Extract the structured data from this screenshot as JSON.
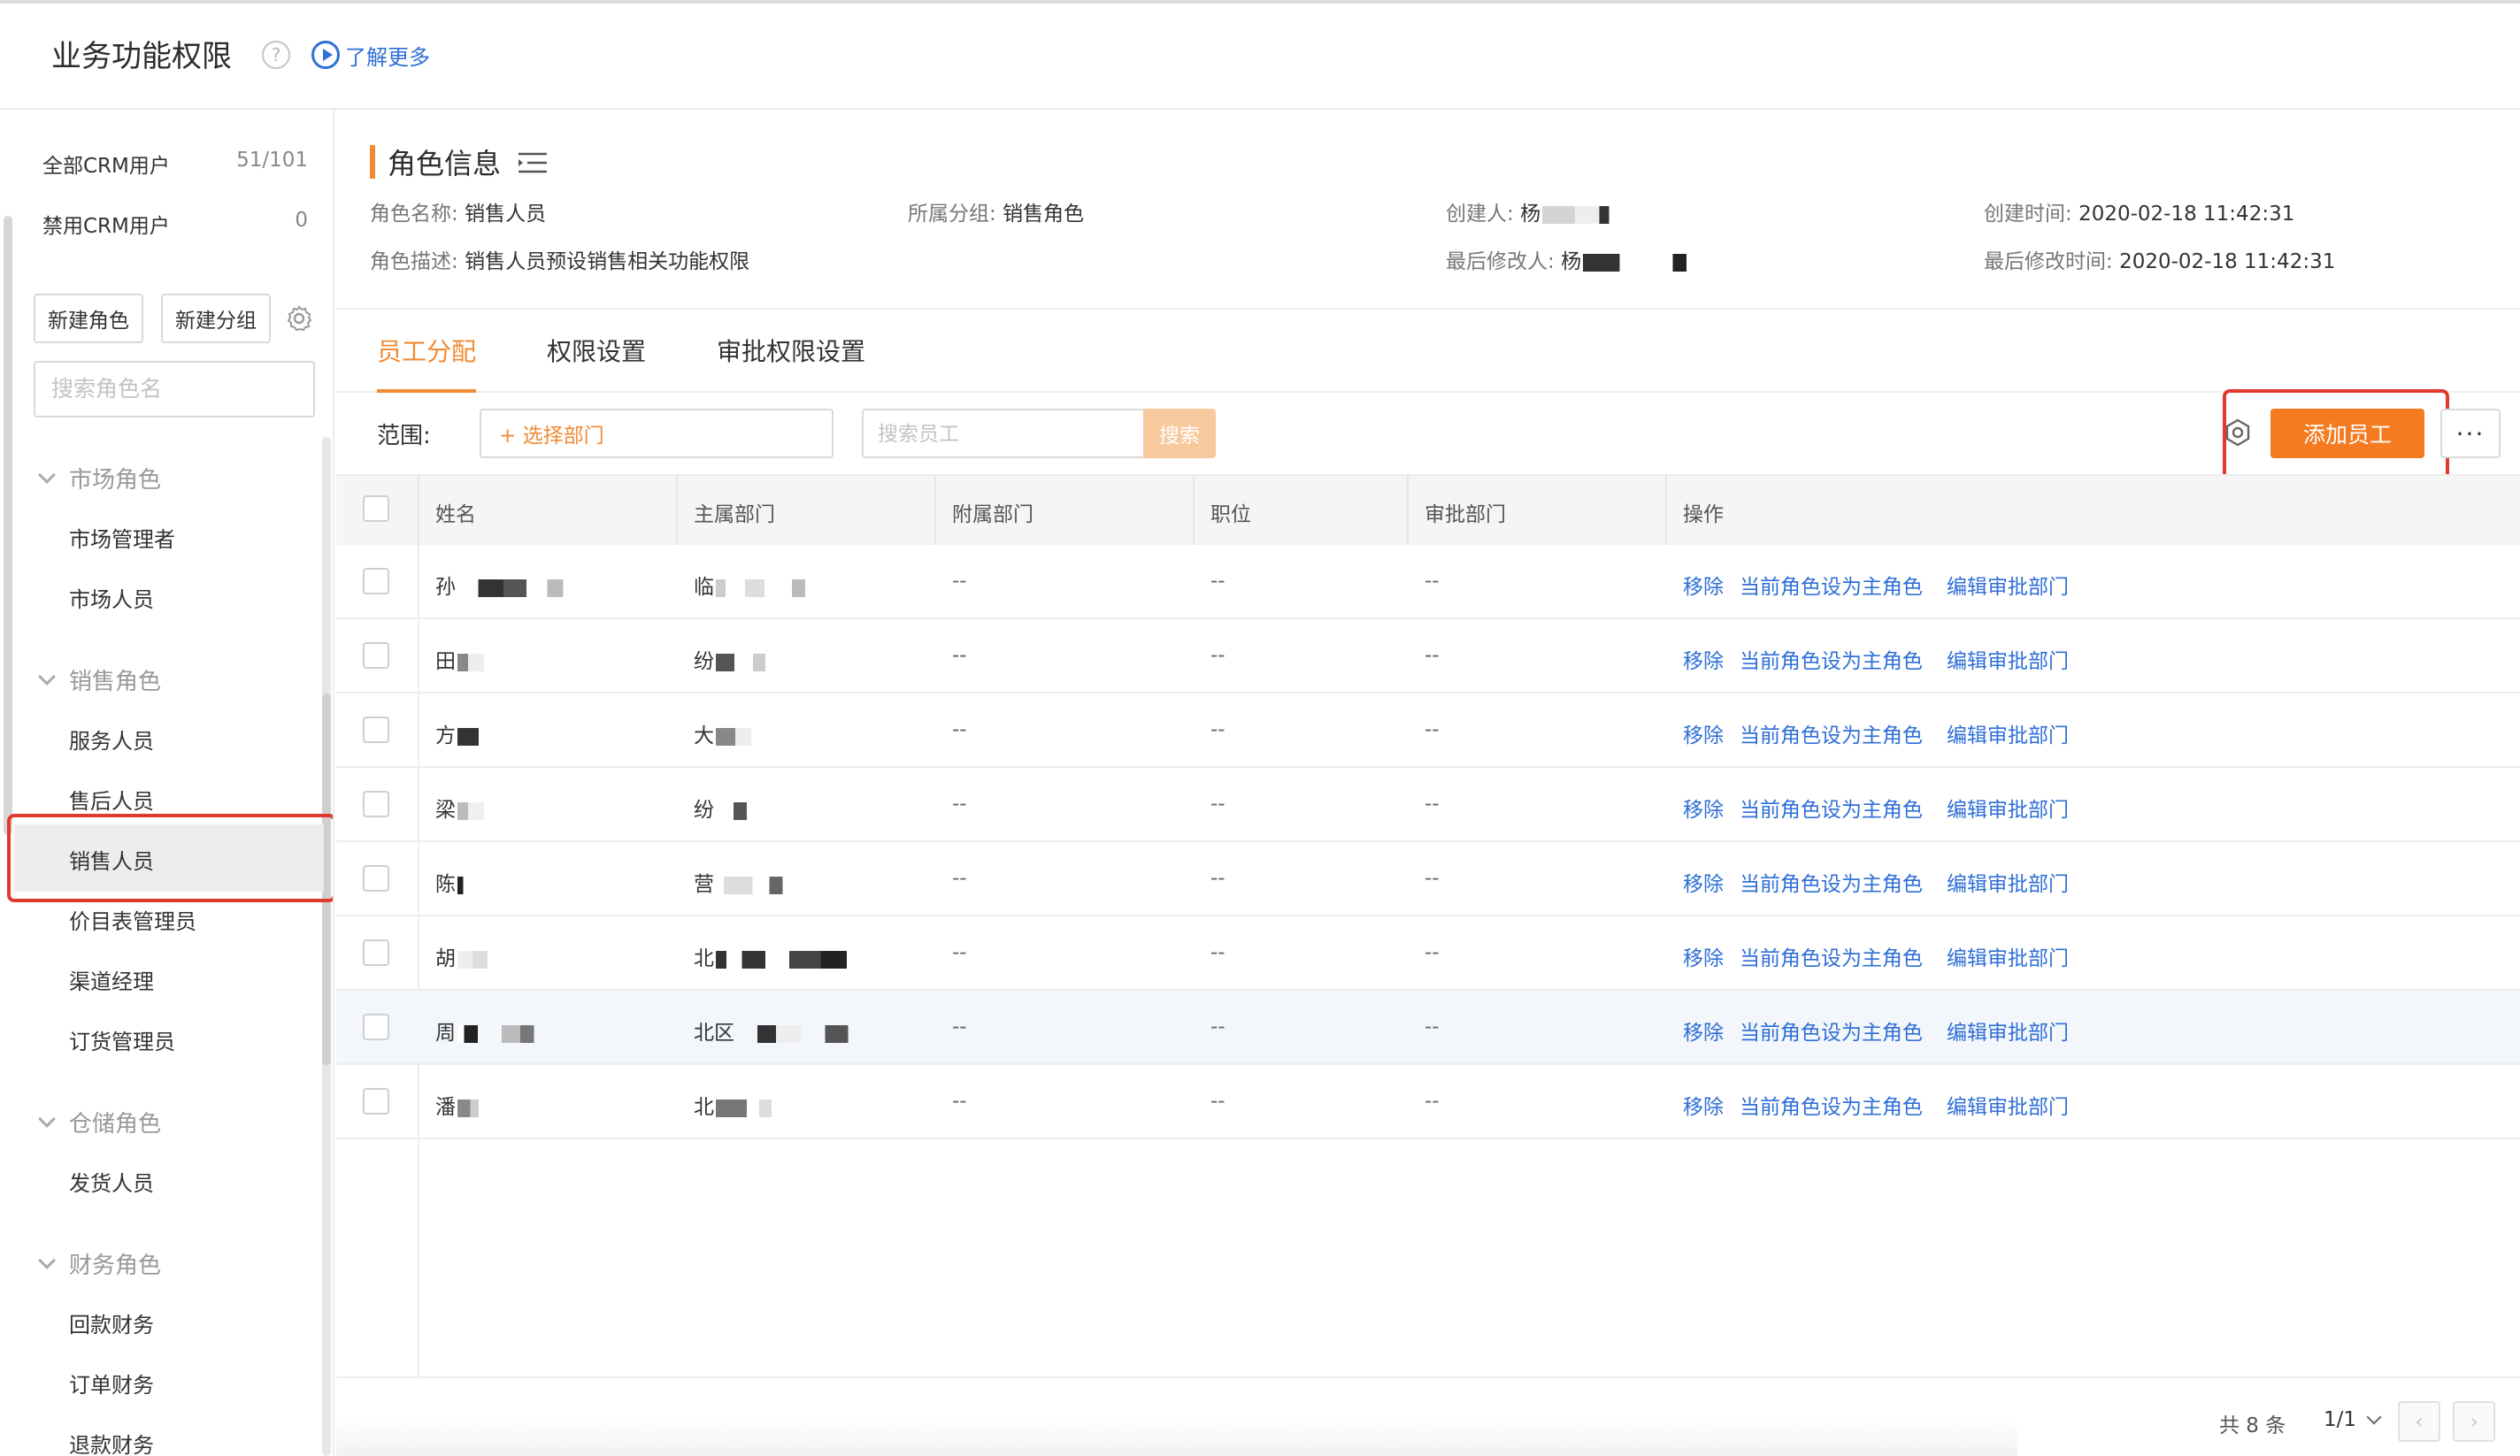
{
  "header": {
    "title": "业务功能权限",
    "help_icon": "?",
    "learn_more": "了解更多"
  },
  "sidebar": {
    "stats": [
      {
        "label": "全部CRM用户",
        "count": "51/101"
      },
      {
        "label": "禁用CRM用户",
        "count": "0"
      }
    ],
    "new_role_button": "新建角色",
    "new_group_button": "新建分组",
    "search_placeholder": "搜索角色名",
    "groups": [
      {
        "label": "市场角色",
        "items": [
          "市场管理者",
          "市场人员"
        ]
      },
      {
        "label": "销售角色",
        "items": [
          "服务人员",
          "售后人员",
          "销售人员",
          "价目表管理员",
          "渠道经理",
          "订货管理员"
        ]
      },
      {
        "label": "仓储角色",
        "items": [
          "发货人员"
        ]
      },
      {
        "label": "财务角色",
        "items": [
          "回款财务",
          "订单财务",
          "退款财务"
        ]
      }
    ],
    "selected_item": "销售人员"
  },
  "role_info": {
    "title": "角色信息",
    "name_label": "角色名称:",
    "name_value": "销售人员",
    "group_label": "所属分组:",
    "group_value": "销售角色",
    "creator_label": "创建人:",
    "creator_value": "杨",
    "create_time_label": "创建时间:",
    "create_time_value": "2020-02-18 11:42:31",
    "desc_label": "角色描述:",
    "desc_value": "销售人员预设销售相关功能权限",
    "modifier_label": "最后修改人:",
    "modifier_value": "杨",
    "modify_time_label": "最后修改时间:",
    "modify_time_value": "2020-02-18 11:42:31"
  },
  "tabs": [
    "员工分配",
    "权限设置",
    "审批权限设置"
  ],
  "active_tab": "员工分配",
  "filter": {
    "range_label": "范围:",
    "dept_select": "+ 选择部门",
    "search_placeholder": "搜索员工",
    "search_button": "搜索",
    "add_employee_button": "添加员工",
    "more_button": "···"
  },
  "table": {
    "columns": [
      "姓名",
      "主属部门",
      "附属部门",
      "职位",
      "审批部门",
      "操作"
    ],
    "rows": [
      {
        "name": "孙",
        "dept": "临",
        "sub": "--",
        "pos": "--",
        "approve": "--"
      },
      {
        "name": "田",
        "dept": "纷",
        "sub": "--",
        "pos": "--",
        "approve": "--"
      },
      {
        "name": "方",
        "dept": "大",
        "sub": "--",
        "pos": "--",
        "approve": "--"
      },
      {
        "name": "梁",
        "dept": "纷",
        "sub": "--",
        "pos": "--",
        "approve": "--"
      },
      {
        "name": "陈",
        "dept": "营",
        "sub": "--",
        "pos": "--",
        "approve": "--"
      },
      {
        "name": "胡",
        "dept": "北",
        "sub": "--",
        "pos": "--",
        "approve": "--"
      },
      {
        "name": "周",
        "dept": "北区",
        "sub": "--",
        "pos": "--",
        "approve": "--"
      },
      {
        "name": "潘",
        "dept": "北",
        "sub": "--",
        "pos": "--",
        "approve": "--"
      }
    ],
    "actions": [
      "移除",
      "当前角色设为主角色",
      "编辑审批部门"
    ]
  },
  "footer": {
    "total": "共 8 条",
    "page": "1/1",
    "prev": "‹",
    "next": "›"
  },
  "colors": {
    "accent": "#f47b20",
    "link": "#2f6fd6",
    "highlight_box": "#e03a2f"
  }
}
